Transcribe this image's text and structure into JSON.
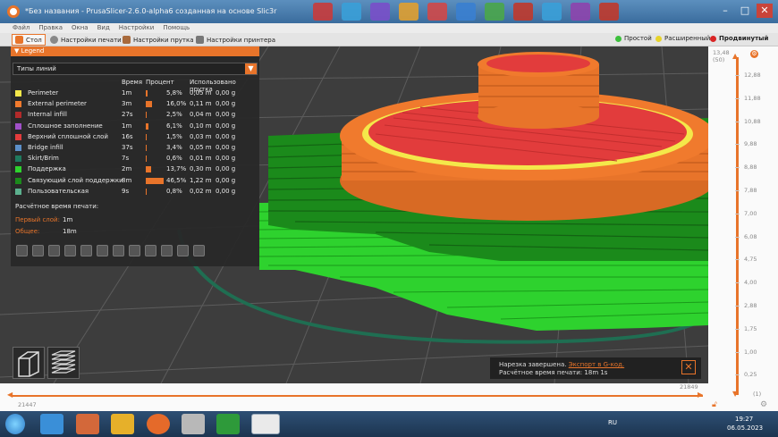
{
  "window": {
    "title": "*Без названия - PrusaSlicer-2.6.0-alpha6 созданная на основе Slic3r"
  },
  "menu": [
    "Файл",
    "Правка",
    "Окна",
    "Вид",
    "Настройки",
    "Помощь"
  ],
  "tabs": [
    {
      "label": "Стол",
      "icon": "plater-icon"
    },
    {
      "label": "Настройки печати",
      "icon": "print-settings-icon"
    },
    {
      "label": "Настройки прутка",
      "icon": "filament-settings-icon"
    },
    {
      "label": "Настройки принтера",
      "icon": "printer-settings-icon"
    }
  ],
  "modes": [
    {
      "label": "Простой",
      "color": "#3cc03c"
    },
    {
      "label": "Расширенный",
      "color": "#e7d32a"
    },
    {
      "label": "Продвинутый",
      "color": "#d92424"
    }
  ],
  "legend": {
    "title": "Legend",
    "type_selector": "Типы линий",
    "columns": {
      "time": "Время",
      "percent": "Процент",
      "used": "Использовано прутка"
    },
    "rows": [
      {
        "name": "Perimeter",
        "time": "1m",
        "percent": "5,8%",
        "pct": 5.8,
        "len": "0,05 m",
        "weight": "0,00 g",
        "color": "#f4e84a"
      },
      {
        "name": "External perimeter",
        "time": "3m",
        "percent": "16,0%",
        "pct": 16.0,
        "len": "0,11 m",
        "weight": "0,00 g",
        "color": "#f07a2d"
      },
      {
        "name": "Internal infill",
        "time": "27s",
        "percent": "2,5%",
        "pct": 2.5,
        "len": "0,04 m",
        "weight": "0,00 g",
        "color": "#b22a2a"
      },
      {
        "name": "Сплошное заполнение",
        "time": "1m",
        "percent": "6,1%",
        "pct": 6.1,
        "len": "0,10 m",
        "weight": "0,00 g",
        "color": "#a050c8"
      },
      {
        "name": "Верхний сплошной слой",
        "time": "16s",
        "percent": "1,5%",
        "pct": 1.5,
        "len": "0,03 m",
        "weight": "0,00 g",
        "color": "#e23c3c"
      },
      {
        "name": "Bridge infill",
        "time": "37s",
        "percent": "3,4%",
        "pct": 3.4,
        "len": "0,05 m",
        "weight": "0,00 g",
        "color": "#5c8fc8"
      },
      {
        "name": "Skirt/Brim",
        "time": "7s",
        "percent": "0,6%",
        "pct": 0.6,
        "len": "0,01 m",
        "weight": "0,00 g",
        "color": "#1f7a5e"
      },
      {
        "name": "Поддержка",
        "time": "2m",
        "percent": "13,7%",
        "pct": 13.7,
        "len": "0,30 m",
        "weight": "0,00 g",
        "color": "#2ed22e"
      },
      {
        "name": "Связующий слой поддержки",
        "time": "8m",
        "percent": "46,5%",
        "pct": 46.5,
        "len": "1,22 m",
        "weight": "0,00 g",
        "color": "#1b8a1b"
      },
      {
        "name": "Пользовательская",
        "time": "9s",
        "percent": "0,8%",
        "pct": 0.8,
        "len": "0,02 m",
        "weight": "0,00 g",
        "color": "#5cb08e"
      }
    ],
    "print_time_title": "Расчётное время печати:",
    "first_layer_label": "Первый слой:",
    "first_layer_value": "1m",
    "total_label": "Общее:",
    "total_value": "18m"
  },
  "vslider": {
    "top_value": "13,48",
    "top_layer": "(50)",
    "ticks": [
      "12,88",
      "11,88",
      "10,88",
      "9,88",
      "8,88",
      "7,88",
      "7,00",
      "6,08",
      "4,75",
      "4,00",
      "2,88",
      "1,75",
      "1,00",
      "0,25"
    ],
    "bottom_layer": "(1)"
  },
  "hslider": {
    "left_value": "21447",
    "right_value": "21849"
  },
  "notification": {
    "text": "Нарезка завершена.",
    "link": "Экспорт в G-код.",
    "time_label": "Расчётное время печати:",
    "time_value": "18m 1s"
  },
  "taskbar": {
    "lang": "RU",
    "time": "19:27",
    "date": "06.05.2023"
  },
  "colors": {
    "accent": "#e8742a",
    "bed": "#3d3d3d",
    "grid": "#7a7a7a"
  }
}
